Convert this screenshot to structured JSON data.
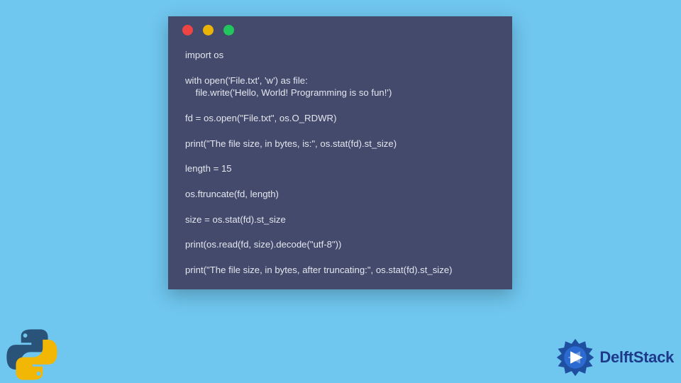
{
  "code": {
    "lines": [
      "import os",
      "",
      "with open('File.txt', 'w') as file:",
      "    file.write('Hello, World! Programming is so fun!')",
      "",
      "fd = os.open(\"File.txt\", os.O_RDWR)",
      "",
      "print(\"The file size, in bytes, is:\", os.stat(fd).st_size)",
      "",
      "length = 15",
      "",
      "os.ftruncate(fd, length)",
      "",
      "size = os.stat(fd).st_size",
      "",
      "print(os.read(fd, size).decode(\"utf-8\"))",
      "",
      "print(\"The file size, in bytes, after truncating:\", os.stat(fd).st_size)"
    ]
  },
  "brand": {
    "name": "DelftStack"
  },
  "colors": {
    "background": "#6fc6ef",
    "window": "#434a6b",
    "code_text": "#e4e6ef",
    "brand_text": "#1e3a8a",
    "dot_red": "#ef4444",
    "dot_yellow": "#eab308",
    "dot_green": "#22c55e"
  }
}
